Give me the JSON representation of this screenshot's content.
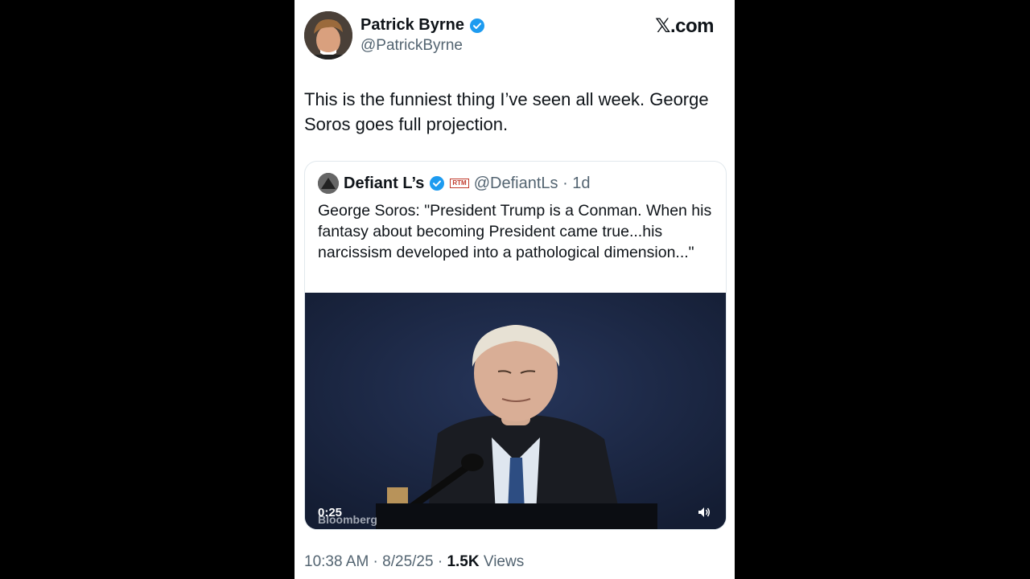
{
  "post": {
    "author_name": "Patrick Byrne",
    "author_handle": "@PatrickByrne",
    "site": "𝕏.com",
    "text": "This is the funniest thing I’ve seen all week. George Soros goes full projection.",
    "timestamp": "10:38 AM · 8/25/25 · ",
    "views_count": "1.5K",
    "views_label": " Views"
  },
  "quote": {
    "author_name": "Defiant L’s",
    "badge": "RTM",
    "handle_age": "@DefiantLs · 1d",
    "text": "George Soros: \"President Trump is a Conman. When his fantasy about becoming President came true...his narcissism developed into a pathological dimension...\""
  },
  "video": {
    "duration": "0:25",
    "watermark": "Bloomberg",
    "icons": [
      "volume-icon"
    ]
  },
  "colors": {
    "background": "#000000",
    "card": "#ffffff",
    "verified": "#1d9bf0",
    "secondary_text": "#536471"
  }
}
